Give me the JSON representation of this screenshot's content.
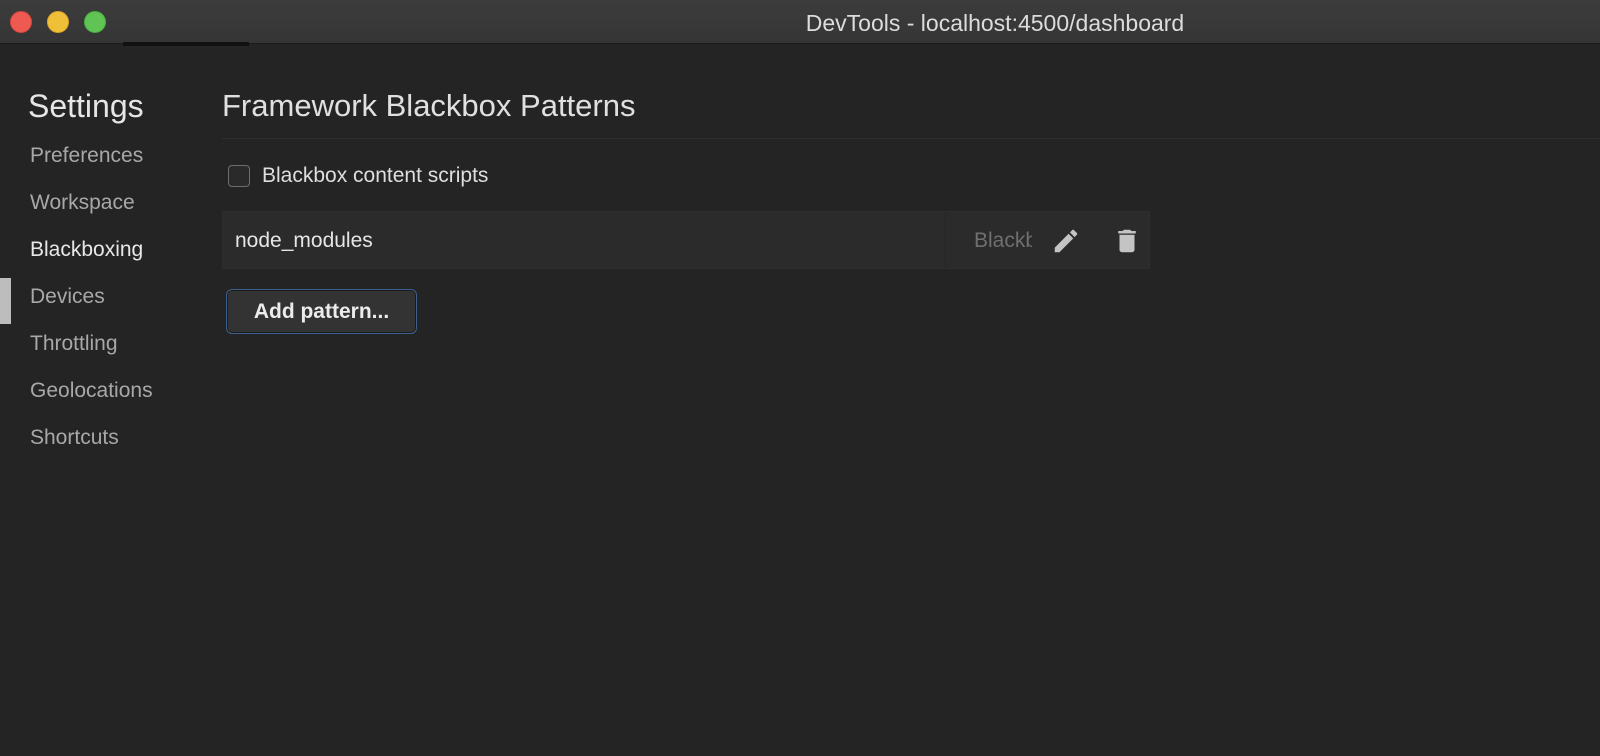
{
  "window": {
    "title": "DevTools - localhost:4500/dashboard"
  },
  "sidebar": {
    "title": "Settings",
    "items": [
      {
        "label": "Preferences",
        "active": false
      },
      {
        "label": "Workspace",
        "active": false
      },
      {
        "label": "Blackboxing",
        "active": true
      },
      {
        "label": "Devices",
        "active": false
      },
      {
        "label": "Throttling",
        "active": false
      },
      {
        "label": "Geolocations",
        "active": false
      },
      {
        "label": "Shortcuts",
        "active": false
      }
    ]
  },
  "main": {
    "title": "Framework Blackbox Patterns",
    "content_scripts_checkbox": {
      "label": "Blackbox content scripts",
      "checked": false
    },
    "patterns": [
      {
        "pattern": "node_modules",
        "behavior": "Blackbox"
      }
    ],
    "add_button_label": "Add pattern..."
  },
  "icons": {
    "edit": "pencil-icon",
    "delete": "trash-icon"
  },
  "colors": {
    "background": "#242424",
    "close": "#ee5a52",
    "minimize": "#f0bf38",
    "maximize": "#5fc454",
    "focus_ring": "#3f5f8f"
  }
}
